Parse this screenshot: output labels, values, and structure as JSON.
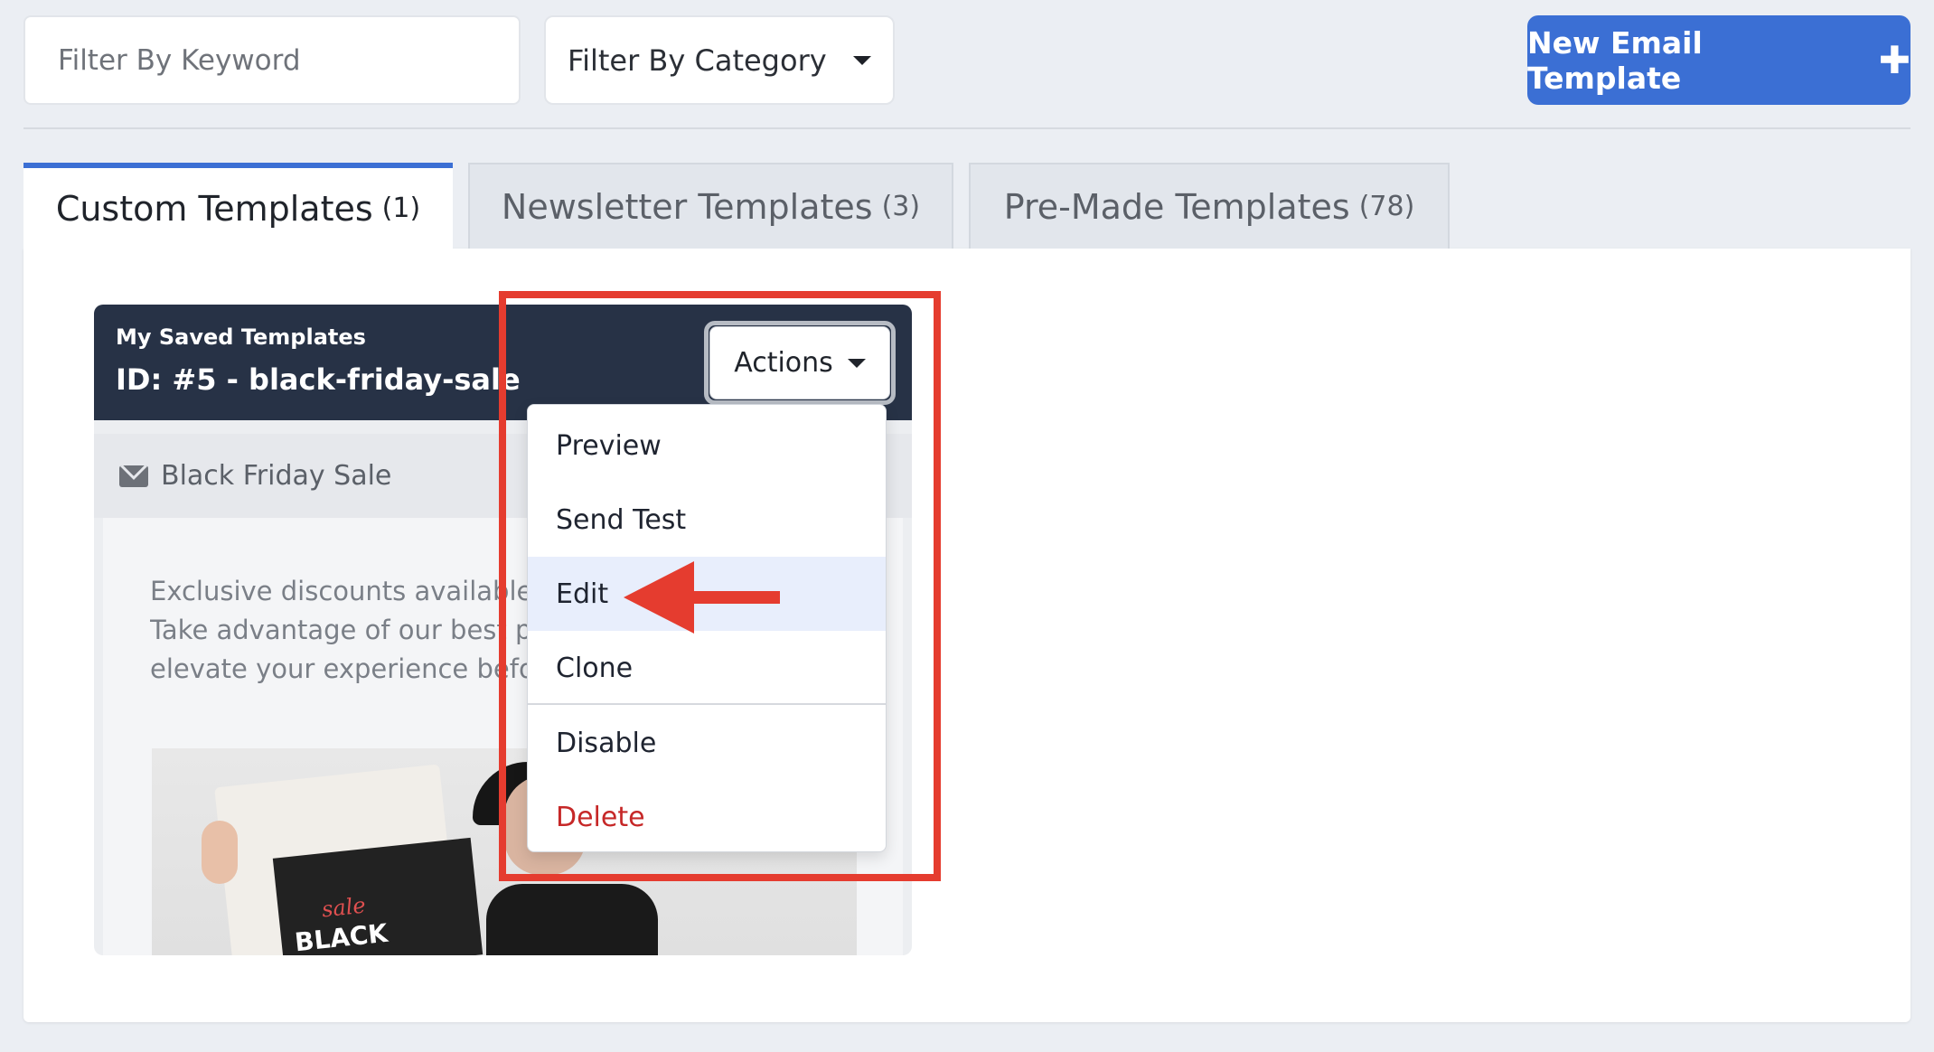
{
  "filters": {
    "keyword_placeholder": "Filter By Keyword",
    "category_label": "Filter By Category"
  },
  "new_template_button": "New Email Template",
  "tabs": [
    {
      "label": "Custom Templates",
      "count": "(1)",
      "active": true
    },
    {
      "label": "Newsletter Templates",
      "count": "(3)",
      "active": false
    },
    {
      "label": "Pre-Made Templates",
      "count": "(78)",
      "active": false
    }
  ],
  "card": {
    "category": "My Saved Templates",
    "title": "ID: #5 - black-friday-sale",
    "subject": "Black Friday Sale",
    "preview_lines": [
      "Exclusive discounts available f",
      "Take advantage of our best pr",
      "elevate your experience befor"
    ],
    "image_text": {
      "script": "sale",
      "headline": "BLACK"
    }
  },
  "actions": {
    "label": "Actions",
    "menu": [
      "Preview",
      "Send Test",
      "Edit",
      "Clone",
      "Disable",
      "Delete"
    ],
    "highlighted": "Edit",
    "danger": "Delete"
  },
  "colors": {
    "primary": "#3b6fd4",
    "card_header": "#273246",
    "danger": "#c62828",
    "annotation": "#e53c2f",
    "menu_highlight": "#e8eefc"
  }
}
